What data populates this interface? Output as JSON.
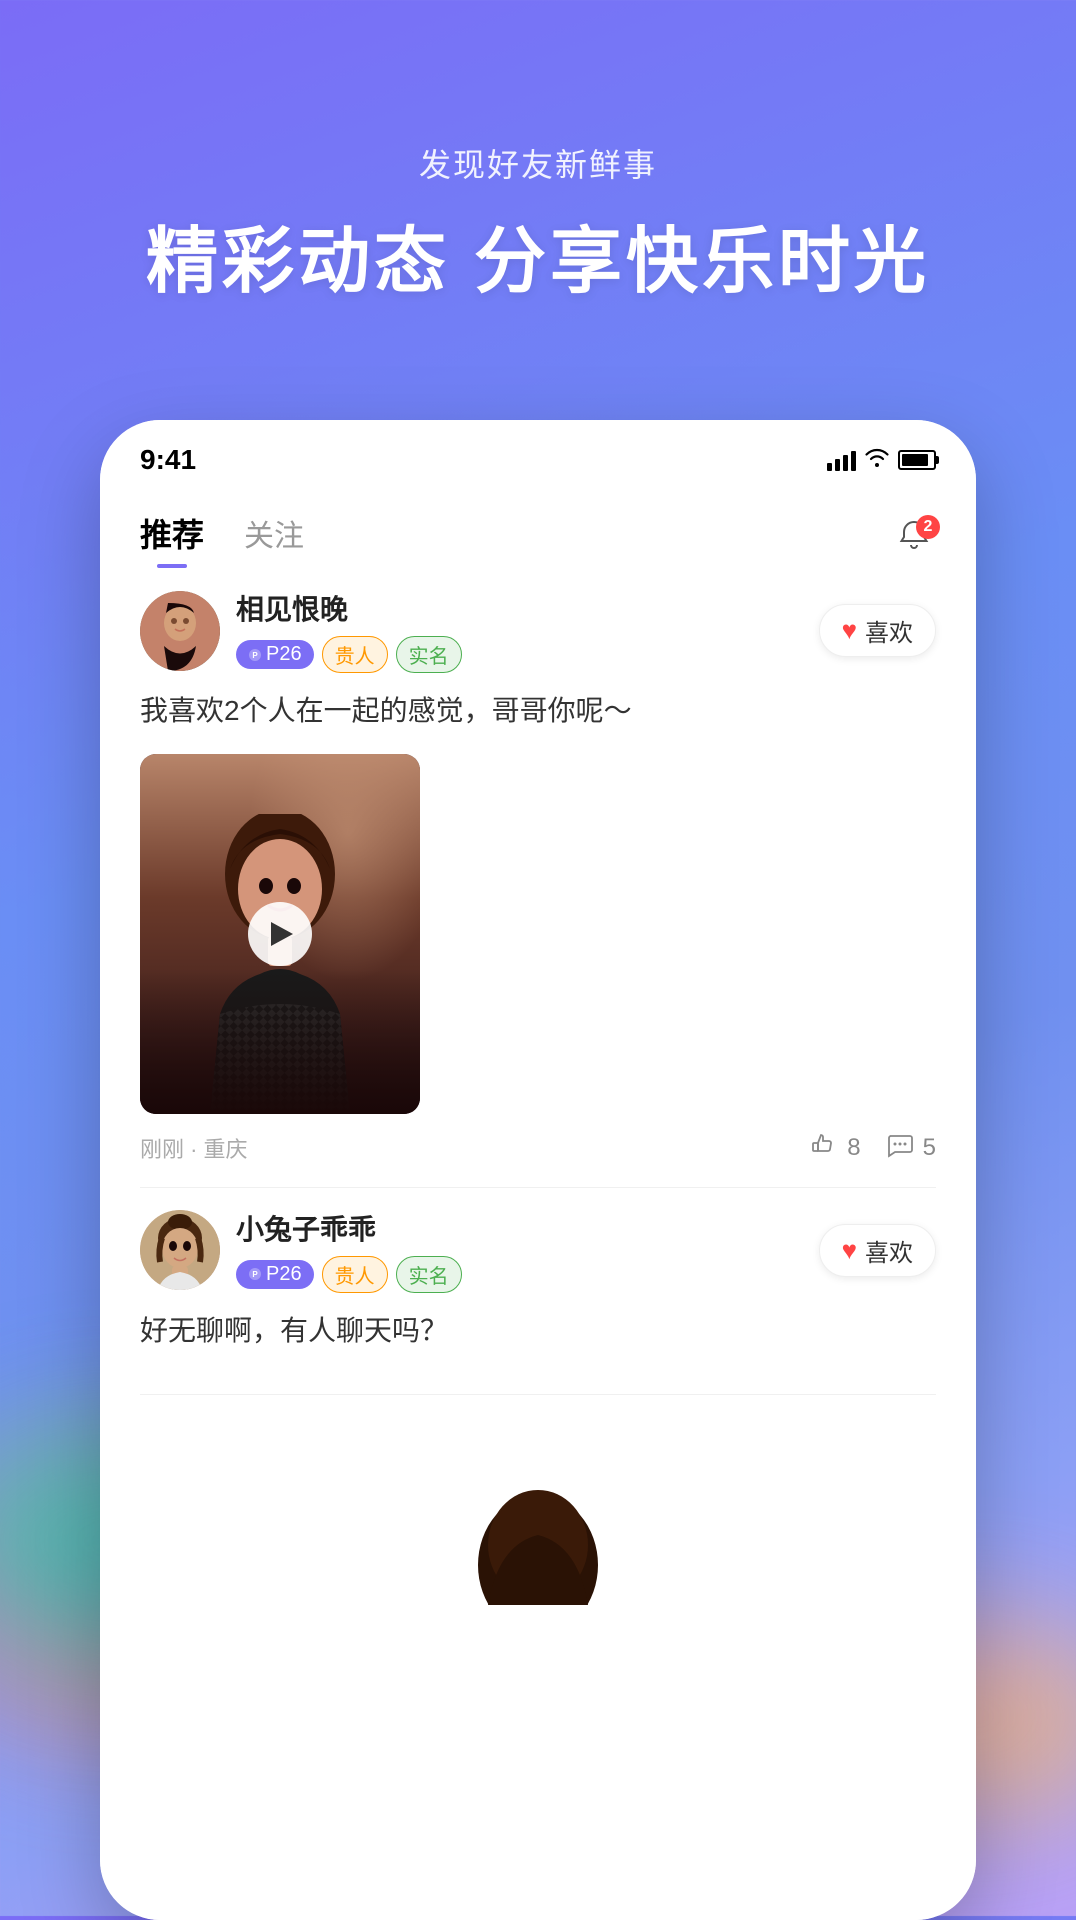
{
  "background": {
    "gradient_start": "#7b6cf6",
    "gradient_end": "#6a8ef5"
  },
  "top_section": {
    "subtitle": "发现好友新鲜事",
    "main_title": "精彩动态 分享快乐时光"
  },
  "phone": {
    "status_bar": {
      "time": "9:41",
      "signal_bars": 4,
      "battery_pct": 85
    },
    "tabs": [
      {
        "label": "推荐",
        "active": true
      },
      {
        "label": "关注",
        "active": false
      }
    ],
    "notification_badge": "2",
    "posts": [
      {
        "id": 1,
        "username": "相见恨晚",
        "tags": [
          {
            "type": "p",
            "label": "P26"
          },
          {
            "type": "real",
            "label": "贵人"
          },
          {
            "type": "verified",
            "label": "实名"
          }
        ],
        "like_label": "喜欢",
        "text": "我喜欢2个人在一起的感觉，哥哥你呢～",
        "has_video": true,
        "meta": "刚刚 · 重庆",
        "likes": "8",
        "comments": "5"
      },
      {
        "id": 2,
        "username": "小兔子乖乖",
        "tags": [
          {
            "type": "p",
            "label": "P26"
          },
          {
            "type": "real",
            "label": "贵人"
          },
          {
            "type": "verified",
            "label": "实名"
          }
        ],
        "like_label": "喜欢",
        "text": "好无聊啊，有人聊天吗？",
        "has_video": false
      }
    ]
  }
}
